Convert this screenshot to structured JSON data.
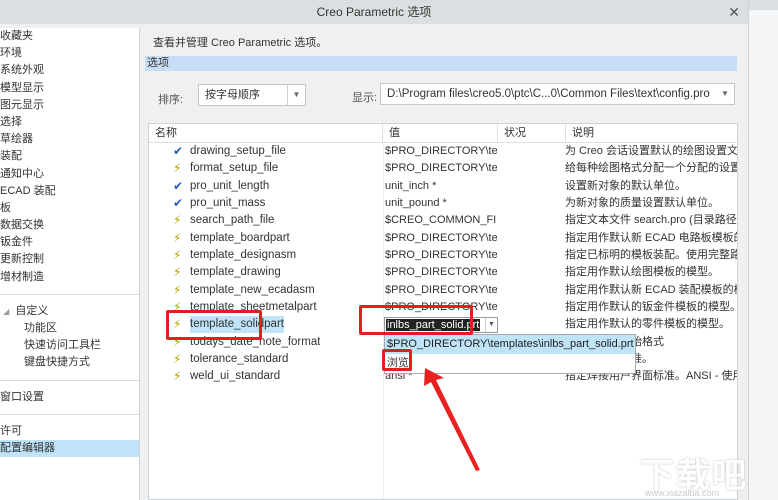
{
  "window": {
    "title": "Creo Parametric 选项",
    "close": "✕"
  },
  "sidebar": {
    "items": [
      "收藏夹",
      "环境",
      "系统外观",
      "模型显示",
      "图元显示",
      "选择",
      "草绘器",
      "装配",
      "通知中心",
      "ECAD 装配",
      "板",
      "数据交换",
      "钣金件",
      "更新控制",
      "增材制造"
    ],
    "customize": {
      "label": "自定义",
      "children": [
        "功能区",
        "快速访问工具栏",
        "键盘快捷方式"
      ]
    },
    "window_settings": "窗口设置",
    "license": "许可",
    "config_editor": "配置编辑器"
  },
  "main": {
    "description": "查看并管理 Creo Parametric 选项。",
    "section": "选项",
    "sort_label": "排序:",
    "sort_value": "按字母顺序",
    "show_label": "显示:",
    "show_value": "D:\\Program files\\creo5.0\\ptc\\C...0\\Common Files\\text\\config.pro"
  },
  "table": {
    "headers": [
      "名称",
      "值",
      "状况",
      "说明"
    ],
    "rows": [
      {
        "icon": "check",
        "name": "drawing_setup_file",
        "value": "$PRO_DIRECTORY\\tex",
        "desc": "为 Creo 会话设置默认的绘图设置文"
      },
      {
        "icon": "bolt",
        "name": "format_setup_file",
        "value": "$PRO_DIRECTORY\\tex",
        "desc": "给每种绘图格式分配一个分配的设置"
      },
      {
        "icon": "check",
        "name": "pro_unit_length",
        "value": "unit_inch *",
        "desc": "设置新对象的默认单位。"
      },
      {
        "icon": "check",
        "name": "pro_unit_mass",
        "value": "unit_pound *",
        "desc": "为新对象的质量设置默认单位。"
      },
      {
        "icon": "bolt",
        "name": "search_path_file",
        "value": "$CREO_COMMON_FIL",
        "desc": "指定文本文件 search.pro (目录路径"
      },
      {
        "icon": "bolt",
        "name": "template_boardpart",
        "value": "$PRO_DIRECTORY\\ter",
        "desc": "指定用作默认新 ECAD 电路板模板的"
      },
      {
        "icon": "bolt",
        "name": "template_designasm",
        "value": "$PRO_DIRECTORY\\ter",
        "desc": "指定已标明的模板装配。使用完整路"
      },
      {
        "icon": "bolt",
        "name": "template_drawing",
        "value": "$PRO_DIRECTORY\\ter",
        "desc": "指定用作默认绘图模板的模型。"
      },
      {
        "icon": "bolt",
        "name": "template_new_ecadasm",
        "value": "$PRO_DIRECTORY\\ter",
        "desc": "指定用作默认新 ECAD 装配模板的模"
      },
      {
        "icon": "bolt",
        "name": "template_sheetmetalpart",
        "value": "$PRO_DIRECTORY\\ter",
        "desc": "指定用作默认的钣金件模板的模型。"
      },
      {
        "icon": "bolt",
        "name": "template_solidpart",
        "value": "",
        "desc": "指定用作默认的零件模板的模型。"
      },
      {
        "icon": "bolt",
        "name": "todays_date_note_format",
        "value": "",
        "desc": "中的日期的初始格式"
      },
      {
        "icon": "bolt",
        "name": "tolerance_standard",
        "value": "",
        "desc": "使用的公差标准。"
      },
      {
        "icon": "bolt",
        "name": "weld_ui_standard",
        "value": "ansi *",
        "desc": "指定焊接用户界面标准。ANSI - 使用"
      }
    ]
  },
  "editor": {
    "value": "inlbs_part_solid.prt",
    "options": [
      "$PRO_DIRECTORY\\templates\\inlbs_part_solid.prt",
      "浏览"
    ]
  },
  "watermark": {
    "text": "下载吧",
    "url": "www.xiazaiba.com"
  },
  "colors": {
    "selection": "#bfe3f7",
    "annotation": "#e02020",
    "status_ok": "#4caf50"
  }
}
